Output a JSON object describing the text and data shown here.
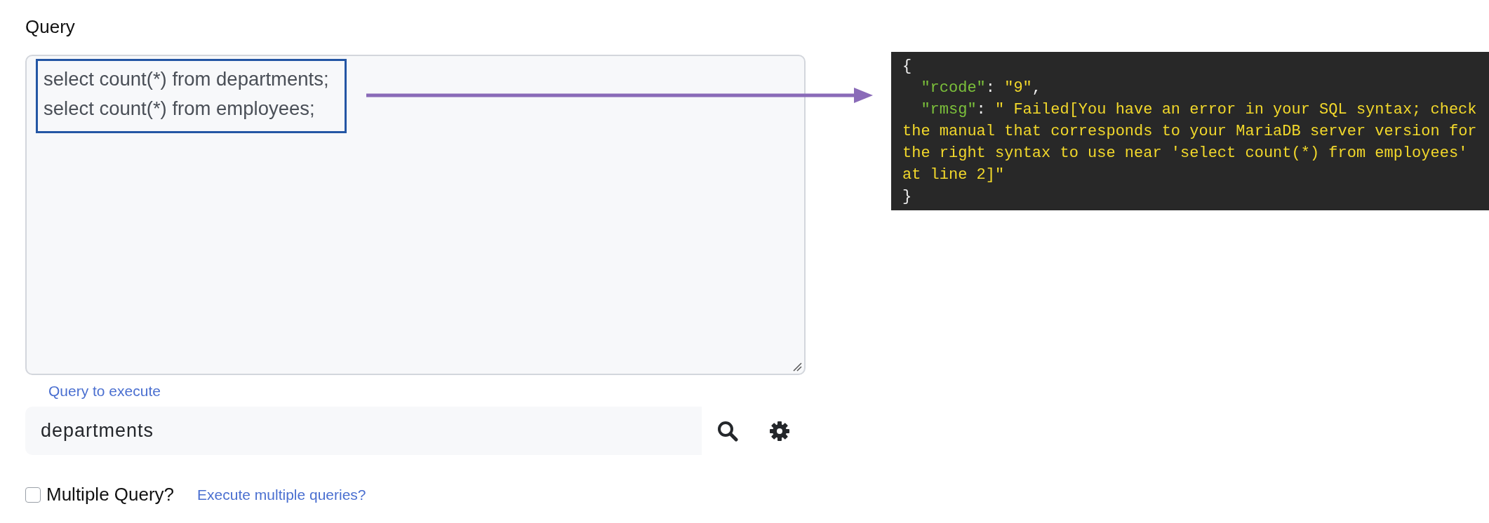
{
  "query_label": "Query",
  "query_text": {
    "lines": [
      "select count(*) from departments;",
      "select count(*) from employees;"
    ]
  },
  "annotation": {
    "highlight": true,
    "arrow": true
  },
  "query_hint": "Query to execute",
  "query_field": {
    "value": "departments"
  },
  "multiple_query": {
    "label": "Multiple Query?",
    "checked": false,
    "link": "Execute multiple queries?"
  },
  "response": {
    "lines": [
      [
        {
          "kind": "punct",
          "text": "{"
        }
      ],
      [
        {
          "kind": "indent"
        },
        {
          "kind": "key",
          "text": "\"rcode\""
        },
        {
          "kind": "punct",
          "text": ": "
        },
        {
          "kind": "string",
          "text": "\"9\""
        },
        {
          "kind": "punct",
          "text": ","
        }
      ],
      [
        {
          "kind": "indent"
        },
        {
          "kind": "key",
          "text": "\"rmsg\""
        },
        {
          "kind": "punct",
          "text": ": "
        },
        {
          "kind": "string",
          "text": "\" Failed[You have an error in your SQL syntax; check"
        }
      ],
      [
        {
          "kind": "string",
          "text": "the manual that corresponds to your MariaDB server version for"
        }
      ],
      [
        {
          "kind": "string",
          "text": "the right syntax to use near 'select count(*) from employees'"
        }
      ],
      [
        {
          "kind": "string",
          "text": "at line 2]\""
        }
      ],
      [
        {
          "kind": "punct",
          "text": "}"
        }
      ]
    ]
  }
}
